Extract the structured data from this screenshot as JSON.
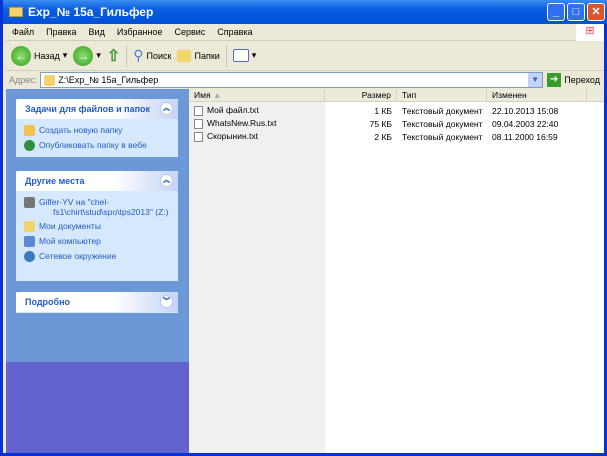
{
  "window": {
    "title": "Exp_№ 15a_Гильфер",
    "minimize": "_",
    "maximize": "□",
    "close": "✕"
  },
  "menu": [
    "Файл",
    "Правка",
    "Вид",
    "Избранное",
    "Сервис",
    "Справка"
  ],
  "toolbar": {
    "back": "Назад",
    "search": "Поиск",
    "folders": "Папки"
  },
  "address": {
    "label": "Адрес:",
    "value": "Z:\\Exp_№ 15a_Гильфер",
    "go": "Переход"
  },
  "sidebar": {
    "tasks": {
      "title": "Задачи для файлов и папок",
      "items": [
        "Создать новую папку",
        "Опубликовать папку в вебе"
      ]
    },
    "places": {
      "title": "Другие места",
      "items": [
        "Gilfer-YV на \"chel-fs1\\chirt\\stud\\spo\\tps2013\" (Z:)",
        "Мои документы",
        "Мой компьютер",
        "Сетевое окружение"
      ]
    },
    "details": {
      "title": "Подробно"
    }
  },
  "files": {
    "columns": [
      "Имя",
      "Размер",
      "Тип",
      "Изменен"
    ],
    "rows": [
      {
        "name": "Мой файл.txt",
        "size": "1 КБ",
        "type": "Текстовый документ",
        "modified": "22.10.2013 15:08"
      },
      {
        "name": "WhatsNew.Rus.txt",
        "size": "75 КБ",
        "type": "Текстовый документ",
        "modified": "09.04.2003 22:40"
      },
      {
        "name": "Скорынин.txt",
        "size": "2 КБ",
        "type": "Текстовый документ",
        "modified": "08.11.2000 16:59"
      }
    ]
  }
}
